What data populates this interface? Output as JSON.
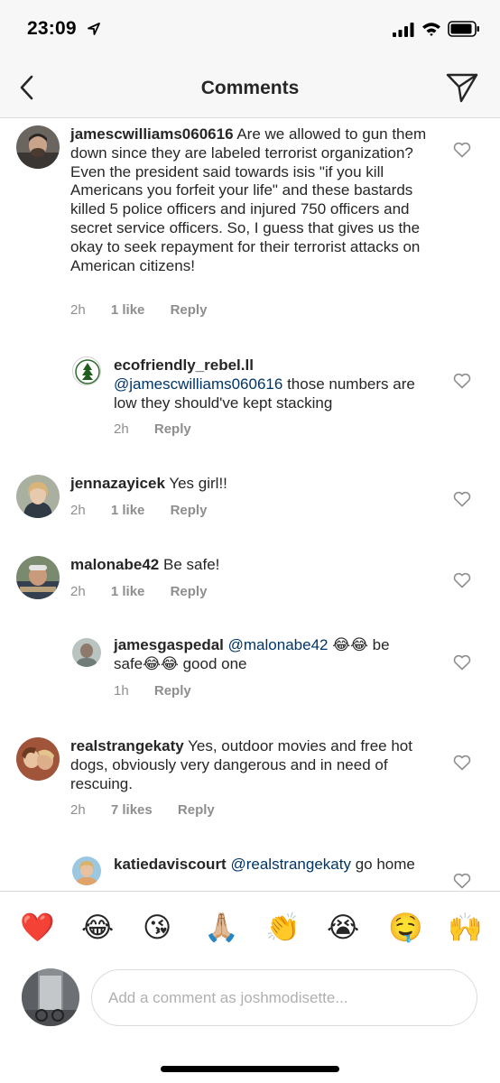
{
  "status": {
    "time": "23:09"
  },
  "nav": {
    "title": "Comments"
  },
  "comments": [
    {
      "username": "jamescwilliams060616",
      "text": "Are we allowed to gun them down since they are labeled terrorist organization? Even the president said towards isis \"if you kill Americans you forfeit your life\" and these bastards killed 5 police officers and injured 750 officers and secret service officers. So, I guess that gives us the okay to seek repayment for their terrorist attacks on American citizens!",
      "time": "2h",
      "likes": "1 like",
      "reply": "Reply"
    },
    {
      "username": "ecofriendly_rebel.ll",
      "mention": "@jamescwilliams060616",
      "text": "those numbers are low they should've kept stacking",
      "time": "2h",
      "reply": "Reply"
    },
    {
      "username": "jennazayicek",
      "text": "Yes girl!!",
      "time": "2h",
      "likes": "1 like",
      "reply": "Reply"
    },
    {
      "username": "malonabe42",
      "text": "Be safe!",
      "time": "2h",
      "likes": "1 like",
      "reply": "Reply"
    },
    {
      "username": "jamesgaspedal",
      "mention": "@malonabe42",
      "text_a": "😂😂 be",
      "text_b": "safe😂😂 good one",
      "time": "1h",
      "reply": "Reply"
    },
    {
      "username": "realstrangekaty",
      "text": "Yes, outdoor movies and free hot dogs, obviously very dangerous and in need of rescuing.",
      "time": "2h",
      "likes": "7 likes",
      "reply": "Reply"
    },
    {
      "username": "katiedaviscourt",
      "mention": "@realstrangekaty",
      "text": "go home"
    }
  ],
  "emojis": [
    "❤️",
    "😂",
    "😘",
    "🙏🏼",
    "👏",
    "😭",
    "🤤",
    "🙌"
  ],
  "composer": {
    "placeholder": "Add a comment as joshmodisette..."
  },
  "colors": {
    "mention": "#003569",
    "meta": "#8e8e8e",
    "heart_red": "#ed4956"
  }
}
